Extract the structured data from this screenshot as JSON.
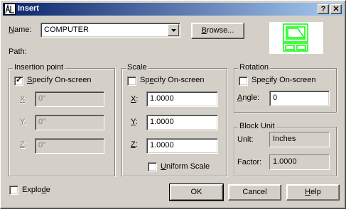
{
  "window": {
    "title": "Insert",
    "help_glyph": "?",
    "close_glyph": "✕"
  },
  "name_row": {
    "label_pre": "",
    "label_u": "N",
    "label_post": "ame:",
    "value": "COMPUTER",
    "browse_pre": "",
    "browse_u": "B",
    "browse_post": "rowse..."
  },
  "path_label": "Path:",
  "insertion": {
    "title": "Insertion point",
    "specify_pre": "",
    "specify_u": "S",
    "specify_post": "pecify On-screen",
    "specify_checked": true,
    "x_label_u": "X",
    "x_label_post": ":",
    "x_value": "0\"",
    "y_label_u": "Y",
    "y_label_post": ":",
    "y_value": "0\"",
    "z_label_u": "Z",
    "z_label_post": ":",
    "z_value": "0\""
  },
  "scale": {
    "title": "Scale",
    "specify_pre": "Sp",
    "specify_u": "e",
    "specify_post": "cify On-screen",
    "specify_checked": false,
    "x_label_u": "X",
    "x_label_post": ":",
    "x_value": "1.0000",
    "y_label_u": "Y",
    "y_label_post": ":",
    "y_value": "1.0000",
    "z_label_u": "Z",
    "z_label_post": ":",
    "z_value": "1.0000",
    "uniform_pre": "",
    "uniform_u": "U",
    "uniform_post": "niform Scale",
    "uniform_checked": false
  },
  "rotation": {
    "title": "Rotation",
    "specify_pre": "Spe",
    "specify_u": "c",
    "specify_post": "ify On-screen",
    "specify_checked": false,
    "angle_pre": "",
    "angle_u": "A",
    "angle_post": "ngle:",
    "angle_value": "0"
  },
  "block_unit": {
    "title": "Block Unit",
    "unit_label": "Unit:",
    "unit_value": "Inches",
    "factor_label": "Factor:",
    "factor_value": "1.0000"
  },
  "explode": {
    "pre": "Explo",
    "u": "d",
    "post": "e",
    "checked": false
  },
  "buttons": {
    "ok": "OK",
    "cancel": "Cancel",
    "help_pre": "",
    "help_u": "H",
    "help_post": "elp"
  },
  "preview_color": "#00ff00"
}
